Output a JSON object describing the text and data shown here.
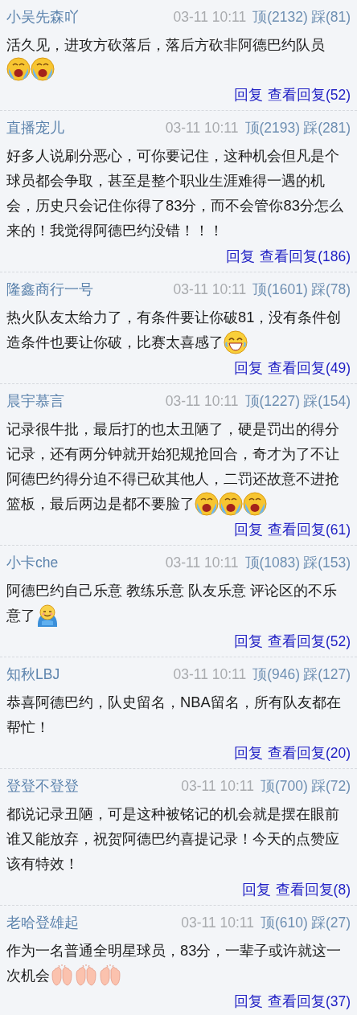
{
  "comments": [
    {
      "user": "小吴先森吖",
      "time": "03-11 10:11",
      "up": "顶(2132)",
      "down": "踩(81)",
      "text": "活久见，进攻方砍落后，落后方砍非阿德巴约队员",
      "emojis": [
        {
          "kind": "crying"
        },
        {
          "kind": "crying"
        }
      ],
      "reply": "回复",
      "view_replies": "查看回复(52)"
    },
    {
      "user": "直播宠儿",
      "time": "03-11 10:11",
      "up": "顶(2193)",
      "down": "踩(281)",
      "text": "好多人说刷分恶心，可你要记住，这种机会但凡是个球员都会争取，甚至是整个职业生涯难得一遇的机会，历史只会记住你得了83分，而不会管你83分怎么来的！我觉得阿德巴约没错！！！",
      "reply": "回复",
      "view_replies": "查看回复(186)"
    },
    {
      "user": "隆鑫商行一号",
      "time": "03-11 10:11",
      "up": "顶(1601)",
      "down": "踩(78)",
      "text": "热火队友太给力了，有条件要让你破81，没有条件创",
      "tail": "造条件也要让你破，比赛太喜感了",
      "emojis": [
        {
          "kind": "laughing"
        }
      ],
      "reply": "回复",
      "view_replies": "查看回复(49)"
    },
    {
      "user": "晨宇慕言",
      "time": "03-11 10:11",
      "up": "顶(1227)",
      "down": "踩(154)",
      "text": "记录很牛批，最后打的也太丑陋了，硬是罚出的得分记录，还有两分钟就开始犯规抢回合，奇才为了不让阿德巴约得分迫不得已砍其他人，二罚还故意不进抢",
      "tail": "篮板，最后两边是都不要脸了",
      "emojis": [
        {
          "kind": "crying"
        },
        {
          "kind": "crying"
        },
        {
          "kind": "crying"
        }
      ],
      "reply": "回复",
      "view_replies": "查看回复(61)"
    },
    {
      "user": "小卡che",
      "time": "03-11 10:11",
      "up": "顶(1083)",
      "down": "踩(153)",
      "text": "阿德巴约自己乐意 教练乐意 队友乐意 评论区的不乐",
      "tail": "意了",
      "emojis": [
        {
          "kind": "wrapped"
        }
      ],
      "reply": "回复",
      "view_replies": "查看回复(52)"
    },
    {
      "user": "知秋LBJ",
      "time": "03-11 10:11",
      "up": "顶(946)",
      "down": "踩(127)",
      "text": "恭喜阿德巴约，队史留名，NBA留名，所有队友都在帮忙！",
      "reply": "回复",
      "view_replies": "查看回复(20)"
    },
    {
      "user": "登登不登登",
      "time": "03-11 10:11",
      "up": "顶(700)",
      "down": "踩(72)",
      "text": "都说记录丑陋，可是这种被铭记的机会就是摆在眼前谁又能放弃，祝贺阿德巴约喜提记录！今天的点赞应该有特效！",
      "reply": "回复",
      "view_replies": "查看回复(8)"
    },
    {
      "user": "老哈登雄起",
      "time": "03-11 10:11",
      "up": "顶(610)",
      "down": "踩(27)",
      "text": "作为一名普通全明星球员，83分，一辈子或许就这一",
      "tail": "次机会",
      "emojis": [
        {
          "kind": "clapping"
        },
        {
          "kind": "clapping"
        },
        {
          "kind": "clapping"
        }
      ],
      "reply": "回复",
      "view_replies": "查看回复(37)"
    }
  ]
}
